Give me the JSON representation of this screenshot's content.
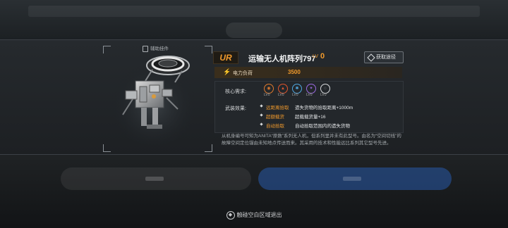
{
  "background": {
    "top_label": "",
    "left_button_label": "",
    "right_button_label": ""
  },
  "plugin_tag": "辅助挂件",
  "item": {
    "rarity": "UR",
    "name": "运输无人机阵列797",
    "level_prefix": "LV",
    "level": "0",
    "acquire_label": "获取途径",
    "power_label": "电力负荷",
    "power_value": "3500",
    "requirements_label": "核心需求:",
    "requirements": [
      {
        "icon": "orange-core-icon",
        "color": "#e07a2c",
        "level": "LV0"
      },
      {
        "icon": "flame-core-icon",
        "color": "#e0552c",
        "level": "LV0"
      },
      {
        "icon": "frost-core-icon",
        "color": "#4fa8e0",
        "level": "LV0"
      },
      {
        "icon": "purple-core-icon",
        "color": "#9b6ae0",
        "level": "LV0"
      },
      {
        "icon": "white-core-icon",
        "color": "#d8dadc",
        "level": "LV0"
      }
    ],
    "modules_label": "武装效果:",
    "modules": [
      {
        "name": "远距离拾取",
        "effect": "遗失货物的拾取距离+1000m"
      },
      {
        "name": "超额载货",
        "effect": "超载载货量+16"
      },
      {
        "name": "自动拾取",
        "effect": "自动拾取范围内的遗失货物"
      }
    ],
    "description": "从机身编号可知为ANITA“原数”系列无人机，但系列里并未有此型号。由名为“空间切线”的故障空间定位锚由未知地点传送而来。其采用的技术和性能远比系列其它型号先进。"
  },
  "exit_hint": "触碰空白区域退出",
  "colors": {
    "accent": "#f19a2c",
    "bg": "#141719",
    "panel": "#262a2e"
  }
}
